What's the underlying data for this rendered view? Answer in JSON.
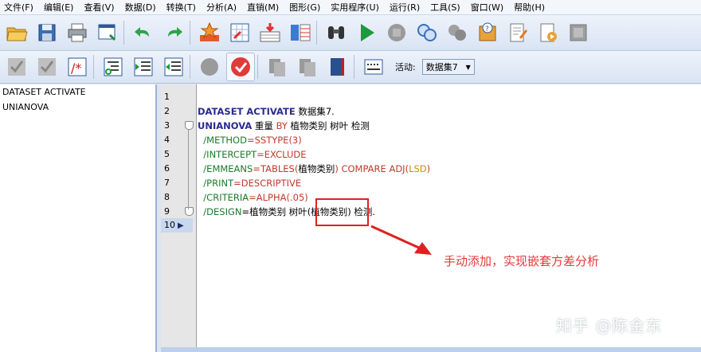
{
  "menu": [
    "文件(F)",
    "编辑(E)",
    "查看(V)",
    "数据(D)",
    "转换(T)",
    "分析(A)",
    "直销(M)",
    "图形(G)",
    "实用程序(U)",
    "运行(R)",
    "工具(S)",
    "窗口(W)",
    "帮助(H)"
  ],
  "toolbar2": {
    "active_label": "活动:",
    "dataset_value": "数据集7"
  },
  "left_pane": {
    "items": [
      "DATASET ACTIVATE",
      "UNIANOVA"
    ]
  },
  "gutter": {
    "line_numbers": [
      "1",
      "2",
      "3",
      "4",
      "5",
      "6",
      "7",
      "8",
      "9",
      "10"
    ]
  },
  "code": {
    "l2_kw": "DATASET ACTIVATE",
    "l2_rest": " 数据集7.",
    "l3_kw": "UNIANOVA",
    "l3_a": " 重量 ",
    "l3_by": "BY",
    "l3_b": " 植物类别 树叶 检测",
    "l4_a": "  /METHOD",
    "l4_b": "=SSTYPE(3)",
    "l5_a": "  /INTERCEPT",
    "l5_b": "=EXCLUDE",
    "l6_a": "  /EMMEANS",
    "l6_b": "=TABLES(",
    "l6_c": "植物类别",
    "l6_d": ") COMPARE ADJ(",
    "l6_e": "LSD",
    "l6_f": ")",
    "l7_a": "  /PRINT",
    "l7_b": "=DESCRIPTIVE",
    "l8_a": "  /CRITERIA",
    "l8_b": "=ALPHA(.05)",
    "l9_a": "  /DESIGN",
    "l9_b": "=植物类别 树叶(植物类别) 检测."
  },
  "annotation": {
    "note": "手动添加，实现嵌套方差分析"
  },
  "watermark": "知乎 @陈金东"
}
